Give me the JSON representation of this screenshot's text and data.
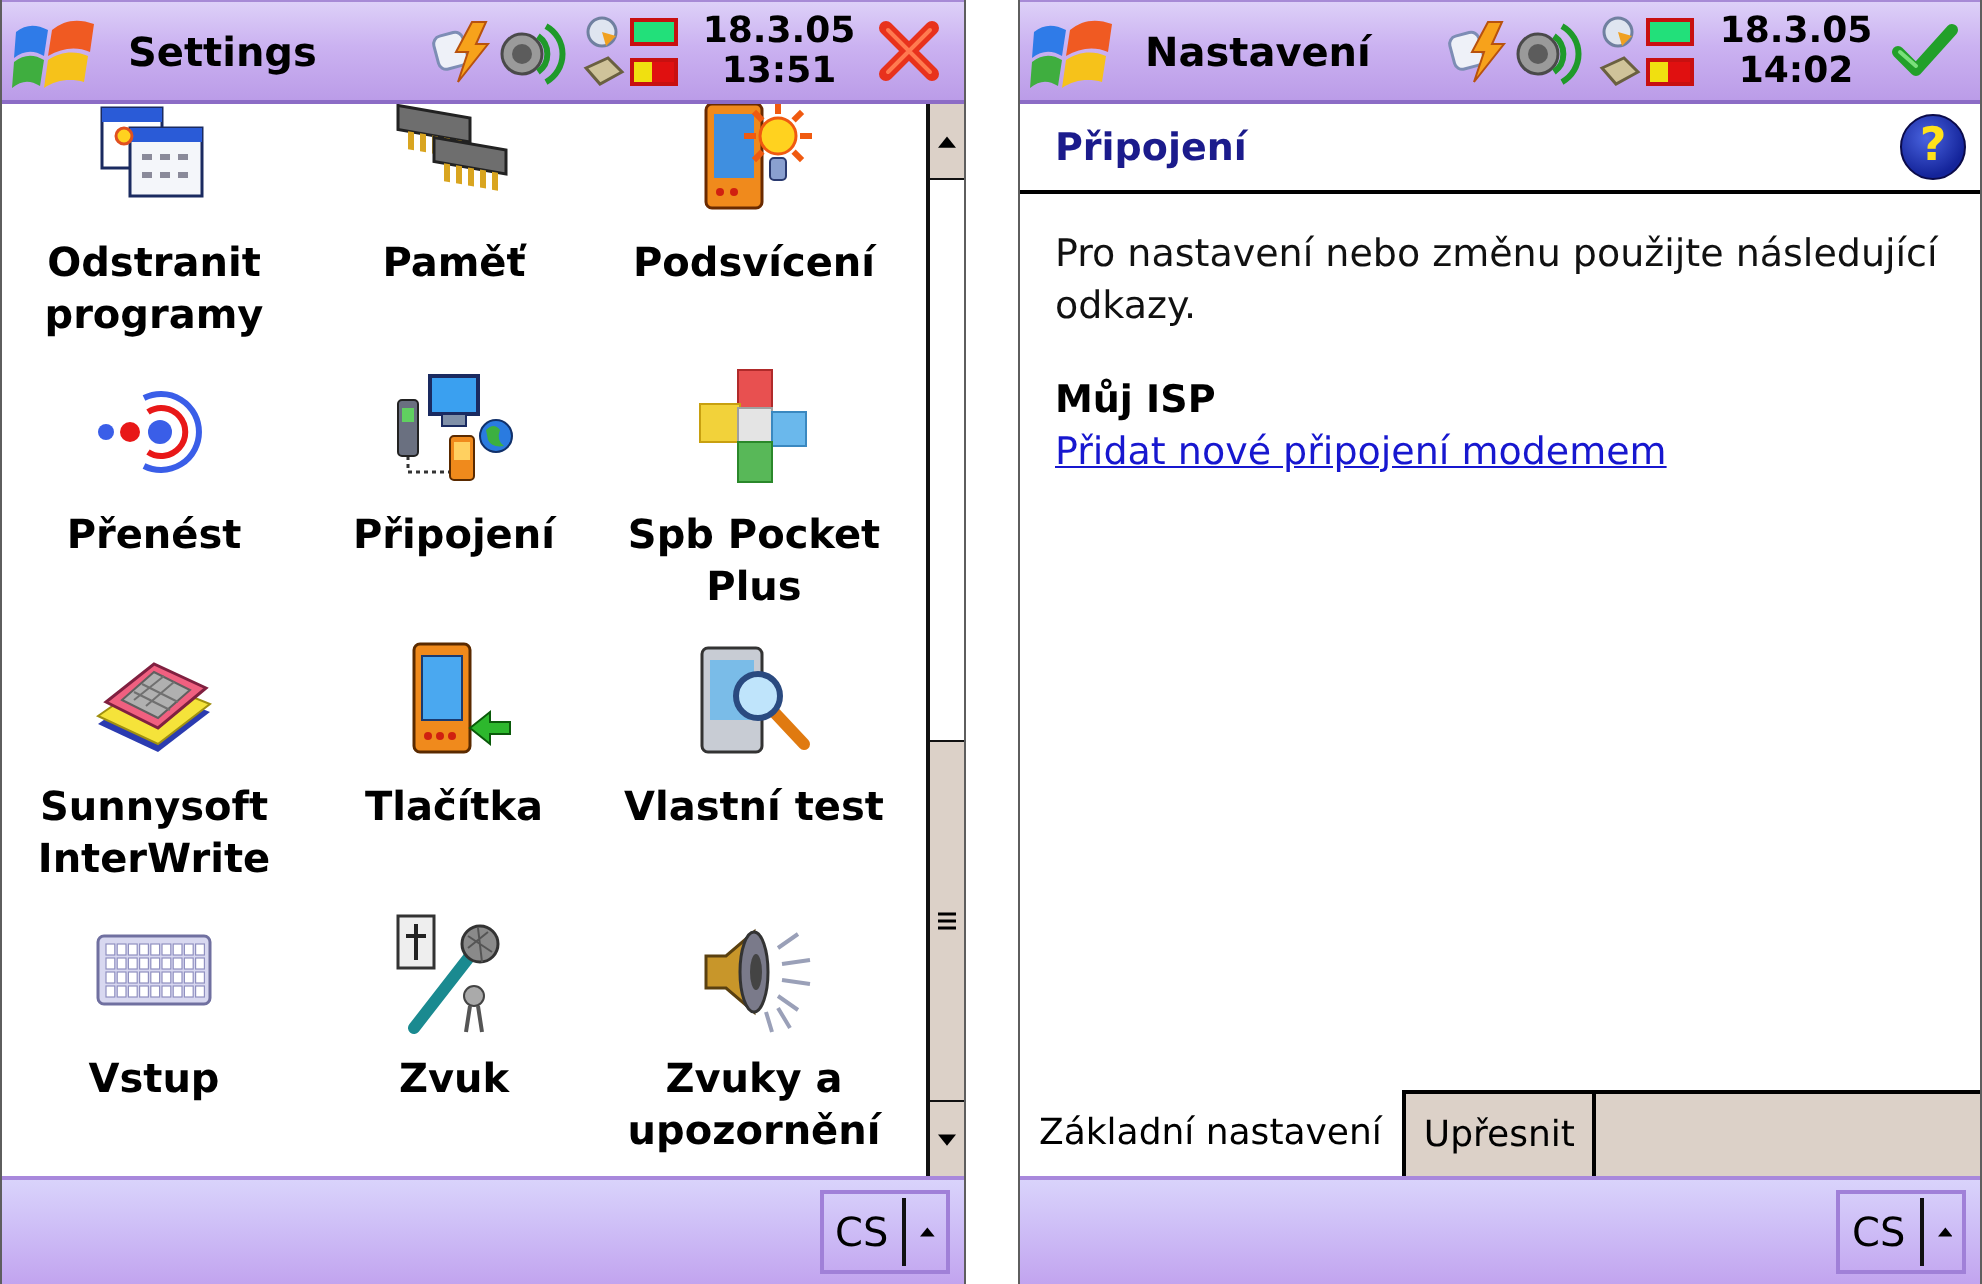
{
  "screens": [
    {
      "kind": "icon_grid",
      "title_bar": {
        "title": "Settings",
        "date": "18.3.05",
        "time": "13:51",
        "action": {
          "kind": "close"
        }
      },
      "items": [
        {
          "label": "Odstranit programy"
        },
        {
          "label": "Paměť"
        },
        {
          "label": "Podsvícení"
        },
        {
          "label": "Přenést"
        },
        {
          "label": "Připojení"
        },
        {
          "label": "Spb Pocket Plus"
        },
        {
          "label": "Sunnysoft InterWrite"
        },
        {
          "label": "Tlačítka"
        },
        {
          "label": "Vlastní test"
        },
        {
          "label": "Vstup"
        },
        {
          "label": "Zvuk"
        },
        {
          "label": "Zvuky a upozornění"
        }
      ],
      "input_method": "CS"
    },
    {
      "kind": "page",
      "title_bar": {
        "title": "Nastavení",
        "date": "18.3.05",
        "time": "14:02",
        "action": {
          "kind": "ok"
        }
      },
      "header": {
        "title": "Připojení",
        "help": "?"
      },
      "intro": "Pro nastavení nebo změnu použijte následující odkazy.",
      "section": {
        "title": "Můj ISP",
        "link": "Přidat nové připojení modemem"
      },
      "tabs": [
        {
          "label": "Základní nastavení",
          "selected": true
        },
        {
          "label": "Upřesnit",
          "selected": false
        }
      ],
      "input_method": "CS"
    }
  ]
}
